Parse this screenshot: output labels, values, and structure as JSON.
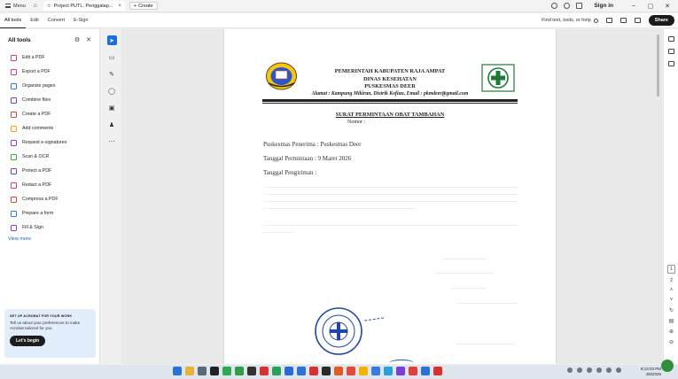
{
  "titlebar": {
    "menu_label": "Menu",
    "tab_label": "Project PUTL, Penggalap...",
    "create_label": "Create",
    "signin_label": "Sign in"
  },
  "menubar": {
    "items": [
      "All tools",
      "Edit",
      "Convert",
      "E-Sign"
    ],
    "active": "All tools",
    "find_label": "Find text, tools, or help",
    "share_label": "Share"
  },
  "leftpanel": {
    "title": "All tools",
    "tools": [
      {
        "label": "Edit a PDF",
        "color": "#d63b8f"
      },
      {
        "label": "Export a PDF",
        "color": "#d63b8f"
      },
      {
        "label": "Organize pages",
        "color": "#2e7be4"
      },
      {
        "label": "Combine files",
        "color": "#6d3fd6"
      },
      {
        "label": "Create a PDF",
        "color": "#e0413b"
      },
      {
        "label": "Add comments",
        "color": "#e9a316"
      },
      {
        "label": "Request e-signatures",
        "color": "#8a3fd6"
      },
      {
        "label": "Scan & OCR",
        "color": "#2ea852"
      },
      {
        "label": "Protect a PDF",
        "color": "#6d3fd6"
      },
      {
        "label": "Redact a PDF",
        "color": "#d63b8f"
      },
      {
        "label": "Compress a PDF",
        "color": "#e0413b"
      },
      {
        "label": "Prepare a form",
        "color": "#2e7be4"
      },
      {
        "label": "Fill & Sign",
        "color": "#8a3fd6"
      }
    ],
    "view_more": "View more",
    "promo": {
      "heading": "SET UP ACROBAT FOR YOUR WORK",
      "text": "Tell us about your preferences to make Acrobat tailored for you",
      "button": "Let's begin"
    }
  },
  "document": {
    "header_lines": [
      "PEMERINTAH KABUPATEN RAJA AMPAT",
      "DINAS KESEHATAN",
      "PUSKESMAS DEER"
    ],
    "address": "Alamat : Kampung Mikiran, Distrik Kofiau, Email : pkmdeer@gmail.com",
    "title": "SURAT PERMINTAAN OBAT TAMBAHAN",
    "nomor_label": "Nomor :",
    "fields": [
      "Puskesmas Penerima  : Puskesmas Deer",
      "Tanggal Permintaan   : 9 Maret 2026",
      "Tanggal Pengiriman    :"
    ]
  },
  "rightpanel": {
    "page_current": "1",
    "page_total": "2"
  },
  "taskbar": {
    "time": "8:13:03 PM",
    "date": "4/8/2026"
  }
}
